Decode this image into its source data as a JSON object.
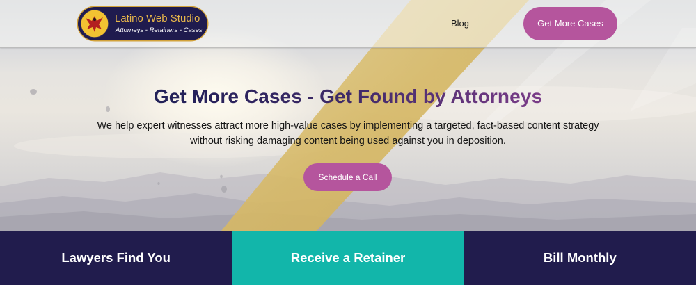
{
  "header": {
    "logo": {
      "title": "Latino Web Studio",
      "tagline": "Attorneys - Retainers - Cases"
    },
    "nav": {
      "blog_label": "Blog"
    },
    "cta_label": "Get More Cases"
  },
  "hero": {
    "title": "Get More Cases - Get Found by Attorneys",
    "description": "We help expert witnesses attract more high-value cases by implementing a targeted, fact-based content strategy without risking damaging content being used against you in deposition.",
    "button_label": "Schedule a Call"
  },
  "features": [
    {
      "label": "Lawyers Find You"
    },
    {
      "label": "Receive a Retainer"
    },
    {
      "label": "Bill Monthly"
    }
  ],
  "colors": {
    "brand_navy": "#211c4d",
    "accent_purple": "#b5559d",
    "accent_teal": "#12b6aa",
    "logo_gold": "#e7b64a",
    "ribbon_gold": "#d9bd6a"
  },
  "icons": {
    "logo_emblem": "eagle-emblem-icon"
  }
}
